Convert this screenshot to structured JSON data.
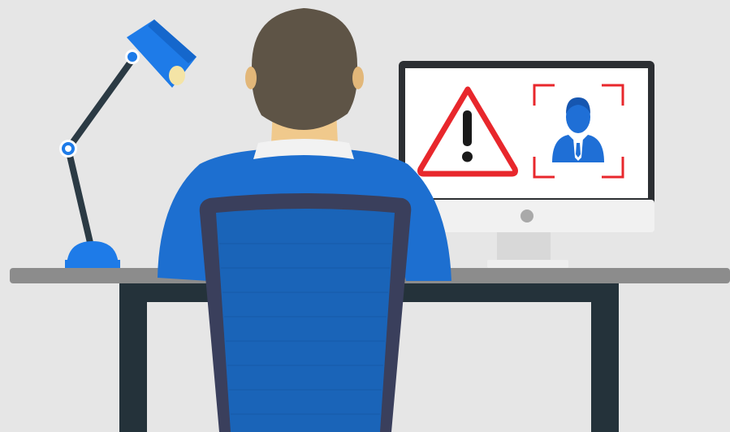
{
  "scene": {
    "colors": {
      "background": "#e6e6e6",
      "desk_top": "#8c8c8c",
      "desk_frame": "#24323a",
      "lamp_blue": "#1e7be8",
      "shirt_blue": "#1d6fd0",
      "chair_frame": "#3a3f5c",
      "chair_back": "#1a64b8",
      "hair": "#5e5446",
      "skin": "#f0c98c",
      "collar": "#f2f2f2",
      "monitor_bezel": "#2c2f33",
      "monitor_screen": "#ffffff",
      "monitor_chin": "#f1f1f1",
      "monitor_stand": "#d8d8d8",
      "warning_red": "#e8272c",
      "user_icon_blue": "#1f6fd6"
    },
    "icons": [
      "warning-triangle-icon",
      "face-recognition-user-icon",
      "desk-lamp-icon"
    ]
  }
}
